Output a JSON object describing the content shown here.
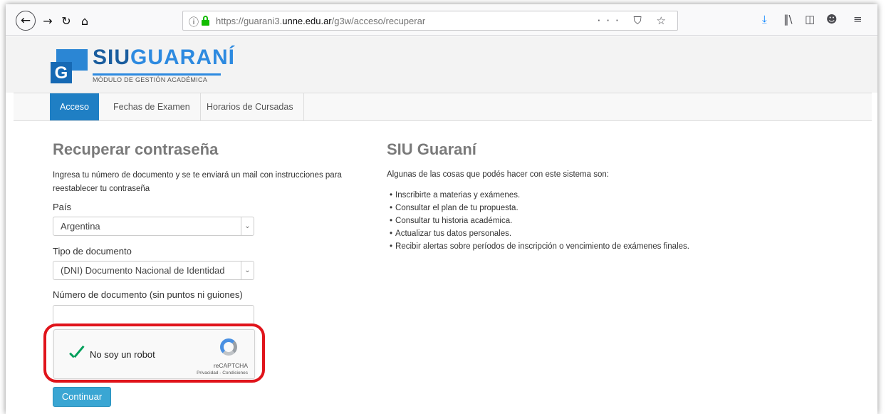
{
  "browser": {
    "url_prefix": "https://guarani3.",
    "url_domain": "unne.edu.ar",
    "url_path": "/g3w/acceso/recuperar",
    "page_actions": "··· ⛉ ☆"
  },
  "header": {
    "logo_letter": "G",
    "logo_siu": "SIU",
    "logo_guarani": "GUARANÍ",
    "logo_subtitle": "MÓDULO DE GESTIÓN ACADÉMICA"
  },
  "nav": {
    "items": [
      {
        "label": "Acceso"
      },
      {
        "label": "Fechas de Examen"
      },
      {
        "label": "Horarios de Cursadas"
      }
    ]
  },
  "form": {
    "title": "Recuperar contraseña",
    "instructions": "Ingresa tu número de documento y se te enviará un mail con instrucciones para reestablecer tu contraseña",
    "country_label": "País",
    "country_value": "Argentina",
    "doc_type_label": "Tipo de documento",
    "doc_type_value": "(DNI) Documento Nacional de Identidad",
    "doc_number_label": "Número de documento (sin puntos ni guiones)",
    "doc_number_value": "",
    "captcha_label": "No soy un robot",
    "captcha_brand": "reCAPTCHA",
    "captcha_links": "Privacidad - Condiciones",
    "submit_label": "Continuar"
  },
  "info": {
    "title": "SIU Guaraní",
    "intro": "Algunas de las cosas que podés hacer con este sistema son:",
    "items": [
      "Inscribirte a materias y exámenes.",
      "Consultar el plan de tu propuesta.",
      "Consultar tu historia académica.",
      "Actualizar tus datos personales.",
      "Recibir alertas sobre períodos de inscripción o vencimiento de exámenes finales."
    ]
  },
  "colors": {
    "accent": "#1f7fc4",
    "button": "#3aa6d3",
    "highlight_ring": "#e0141b",
    "check": "#029f5b"
  },
  "icons": [
    "back-icon",
    "forward-icon",
    "reload-icon",
    "home-icon",
    "info-icon",
    "lock-icon",
    "download-icon",
    "library-icon",
    "sidebar-icon",
    "account-icon",
    "menu-icon",
    "dropdown-arrow-icon",
    "recaptcha-icon",
    "checkmark-icon"
  ]
}
